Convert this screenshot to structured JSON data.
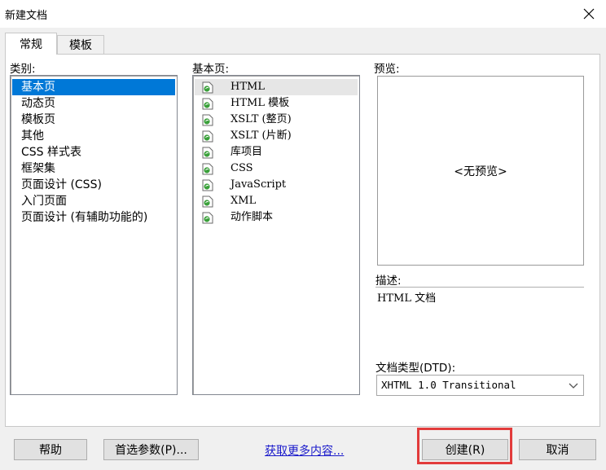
{
  "window": {
    "title": "新建文档"
  },
  "tabs": [
    {
      "label": "常规"
    },
    {
      "label": "模板"
    }
  ],
  "category": {
    "label": "类别:",
    "items": [
      {
        "label": "基本页"
      },
      {
        "label": "动态页"
      },
      {
        "label": "模板页"
      },
      {
        "label": "其他"
      },
      {
        "label": "CSS 样式表"
      },
      {
        "label": "框架集"
      },
      {
        "label": "页面设计 (CSS)"
      },
      {
        "label": "入门页面"
      },
      {
        "label": "页面设计 (有辅助功能的)"
      }
    ]
  },
  "basic_page": {
    "label": "基本页:",
    "items": [
      {
        "label": "HTML"
      },
      {
        "label": "HTML 模板"
      },
      {
        "label": "XSLT (整页)"
      },
      {
        "label": "XSLT (片断)"
      },
      {
        "label": "库项目"
      },
      {
        "label": "CSS"
      },
      {
        "label": "JavaScript"
      },
      {
        "label": "XML"
      },
      {
        "label": "动作脚本"
      }
    ]
  },
  "preview": {
    "label": "预览:",
    "placeholder": "<无预览>"
  },
  "description": {
    "label": "描述:",
    "text": "HTML 文档"
  },
  "doctype": {
    "label": "文档类型(DTD):",
    "value": "XHTML 1.0 Transitional"
  },
  "buttons": {
    "help": "帮助",
    "preferences": "首选参数(P)...",
    "more_content": "获取更多内容...",
    "create": "创建(R)",
    "cancel": "取消"
  },
  "colors": {
    "selection": "#0078d7",
    "highlight_border": "#e23b3b",
    "link": "#1a1acb",
    "page_icon": "#3aa03a"
  }
}
